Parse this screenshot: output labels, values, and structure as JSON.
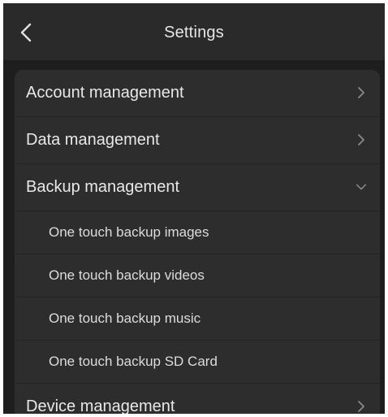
{
  "header": {
    "title": "Settings"
  },
  "menu": {
    "account": "Account management",
    "data": "Data management",
    "backup": "Backup management",
    "backup_items": [
      "One touch backup images",
      "One touch backup videos",
      "One touch backup music",
      "One touch backup SD Card"
    ],
    "device": "Device management"
  },
  "colors": {
    "background": "#1e1e1e",
    "header": "#2a2a2a",
    "panel": "#2d2d2d",
    "text": "#e8e8e8",
    "icon": "#8a8a8a"
  },
  "icons": {
    "back": "chevron-left-icon",
    "forward": "chevron-right-icon",
    "expanded": "chevron-down-icon"
  }
}
